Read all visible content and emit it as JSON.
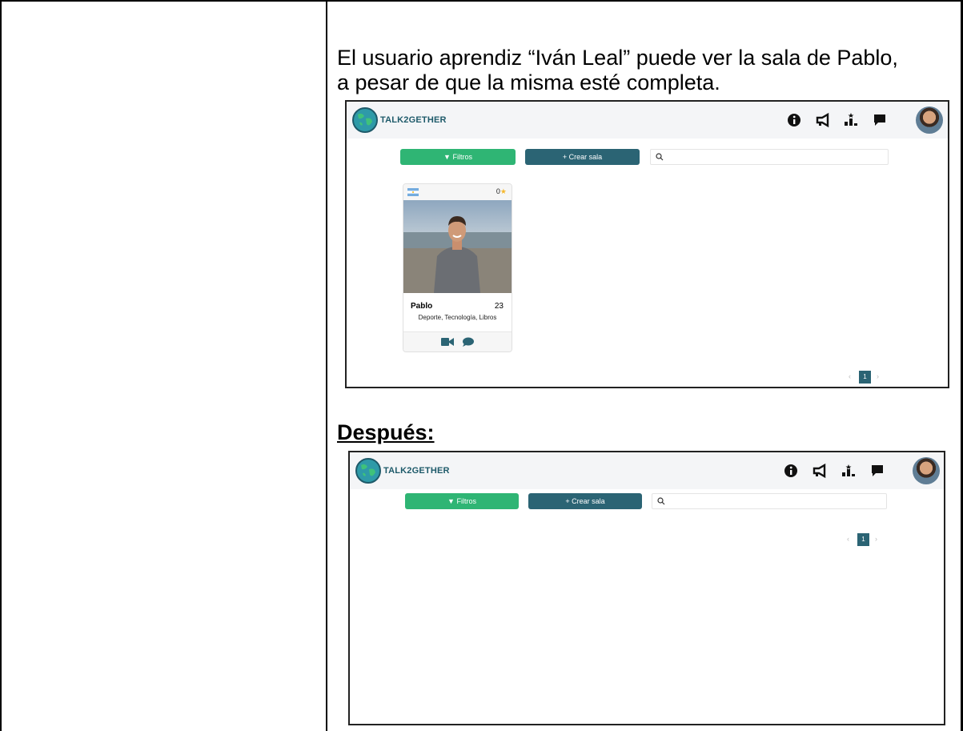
{
  "document": {
    "description_line1": "El usuario aprendiz “Iván Leal” puede ver la sala de Pablo,",
    "description_line2": "a pesar de que la misma esté completa.",
    "after_heading": "Después:"
  },
  "app": {
    "brand": "TALK2GETHER",
    "filtros_label": "Filtros",
    "crear_sala_label": "+ Crear sala",
    "search_placeholder": "",
    "nav_icons": [
      "info-icon",
      "megaphone-icon",
      "ranking-icon",
      "chat-icon"
    ],
    "current_page": "1",
    "colors": {
      "filtros": "#2fb574",
      "crear_sala": "#2b6474",
      "brand_text": "#1e5a6a",
      "rating_star": "#f5b82e"
    }
  },
  "room_card": {
    "name": "Pablo",
    "age": "23",
    "interests": "Deporte, Tecnología, Libros",
    "rating": "0",
    "country_flag": "argentina-flag-icon",
    "actions": [
      "video-icon",
      "chat-bubble-icon"
    ]
  }
}
